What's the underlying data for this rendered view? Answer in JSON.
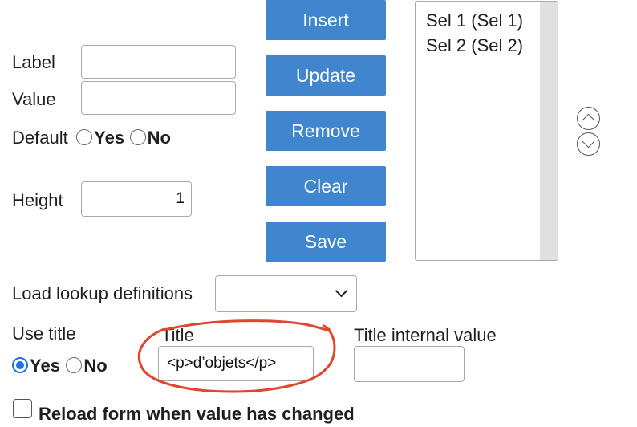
{
  "form": {
    "label_label": "Label",
    "label_value": "",
    "value_label": "Value",
    "value_value": "",
    "default_label": "Default",
    "default_yes": "Yes",
    "default_no": "No",
    "height_label": "Height",
    "height_value": "1",
    "load_lookup_label": "Load lookup definitions",
    "load_lookup_selected": "",
    "use_title_label": "Use title",
    "use_title_yes": "Yes",
    "use_title_no": "No",
    "use_title_selected": "Yes",
    "title_label": "Title",
    "title_value": "<p>d’objets</p>",
    "title_internal_label": "Title internal value",
    "title_internal_value": "",
    "reload_label": "Reload form when value has changed",
    "reload_checked": false
  },
  "buttons": {
    "insert": "Insert",
    "update": "Update",
    "remove": "Remove",
    "clear": "Clear",
    "save": "Save"
  },
  "listbox": {
    "options": [
      "Sel 1 (Sel 1)",
      "Sel 2 (Sel 2)"
    ]
  },
  "icons": {
    "move_up": "chevron-up-circle-icon",
    "move_down": "chevron-down-circle-icon"
  },
  "colors": {
    "button_bg": "#3f86cf",
    "button_text": "#ffffff",
    "radio_checked": "#1a73e8",
    "annotation": "#e0452d"
  }
}
